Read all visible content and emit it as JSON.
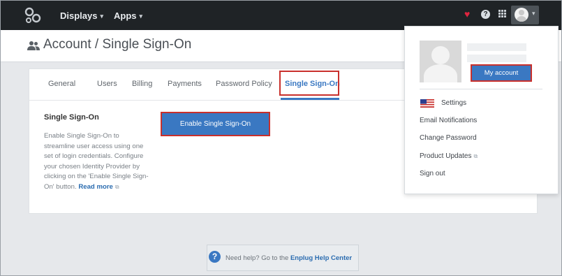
{
  "nav": {
    "displays_label": "Displays",
    "apps_label": "Apps"
  },
  "page": {
    "title": "Account / Single Sign-On"
  },
  "tabs": [
    {
      "label": "General"
    },
    {
      "label": "Users"
    },
    {
      "label": "Billing"
    },
    {
      "label": "Payments"
    },
    {
      "label": "Password Policy"
    },
    {
      "label": "Single Sign-On",
      "active": true
    }
  ],
  "sso": {
    "heading": "Single Sign-On",
    "description": "Enable Single Sign-On to streamline user access using one set of login credentials. Configure your chosen Identity Provider by clicking on the 'Enable Single Sign-On' button.",
    "read_more": "Read more",
    "enable_button": "Enable Single Sign-On"
  },
  "help": {
    "prefix": "Need help? Go to the",
    "link": "Enplug Help Center"
  },
  "dropdown": {
    "my_account_button": "My account",
    "items": {
      "settings": "Settings",
      "email_notifications": "Email Notifications",
      "change_password": "Change Password",
      "product_updates": "Product Updates",
      "sign_out": "Sign out"
    }
  },
  "colors": {
    "brand_blue": "#3a78c2",
    "topbar": "#1f2326",
    "highlight_red": "#c9302c",
    "heart": "#e0253f"
  },
  "icons": [
    "enplug-logo-icon",
    "chevron-down-icon",
    "heart-icon",
    "help-icon",
    "apps-grid-icon",
    "avatar-icon",
    "users-icon",
    "external-link-icon",
    "us-flag-icon",
    "question-circle-icon"
  ]
}
